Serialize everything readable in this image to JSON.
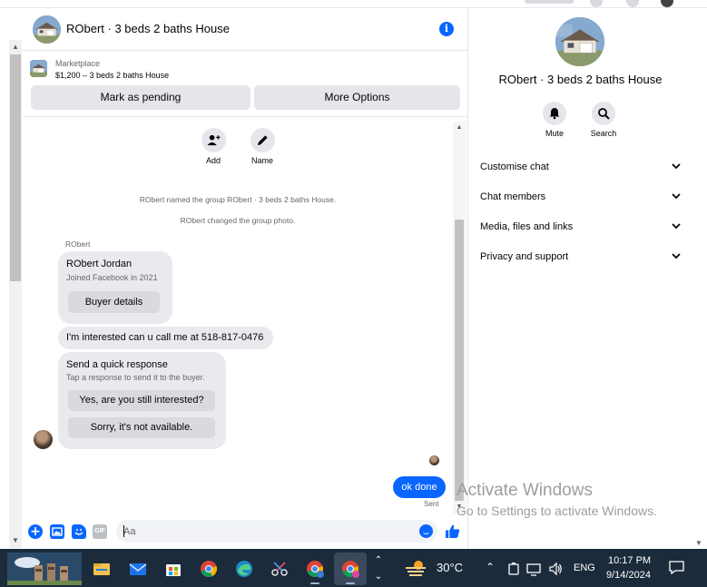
{
  "chat": {
    "title": "RObert · 3 beds 2 baths House",
    "marketplace_label": "Marketplace",
    "listing": "$1,200 – 3 beds 2 baths House",
    "pending_button": "Mark as pending",
    "options_button": "More Options"
  },
  "actions": [
    {
      "label": "Add",
      "icon": "add-person-icon"
    },
    {
      "label": "Name",
      "icon": "pencil-icon"
    }
  ],
  "system_messages": [
    "RObert named the group RObert · 3 beds 2 baths House.",
    "RObert changed the group photo."
  ],
  "sender_name": "RObert",
  "buyer_card": {
    "name": "RObert Jordan",
    "joined": "Joined Facebook in 2021",
    "button": "Buyer details"
  },
  "incoming_message": "I'm interested can u call me at 518-817-0476",
  "quick_response": {
    "title": "Send a quick response",
    "subtitle": "Tap a response to send it to the buyer.",
    "options": [
      "Yes, are you still interested?",
      "Sorry, it's not available."
    ]
  },
  "outgoing_message": "ok done",
  "sent_status": "Sent",
  "composer": {
    "placeholder": "Aa",
    "gif_label": "GIF"
  },
  "info_panel": {
    "title": "RObert · 3 beds 2 baths House",
    "mute_label": "Mute",
    "search_label": "Search",
    "sections": [
      "Customise chat",
      "Chat members",
      "Media, files and links",
      "Privacy and support"
    ]
  },
  "watermark": {
    "title": "Activate Windows",
    "subtitle": "Go to Settings to activate Windows."
  },
  "taskbar": {
    "temperature": "30°C",
    "language": "ENG",
    "time": "10:17 PM",
    "date": "9/14/2024"
  },
  "colors": {
    "accent": "#0866ff",
    "bubble_gray": "#e9eaee",
    "taskbar": "#1c2b3c"
  }
}
